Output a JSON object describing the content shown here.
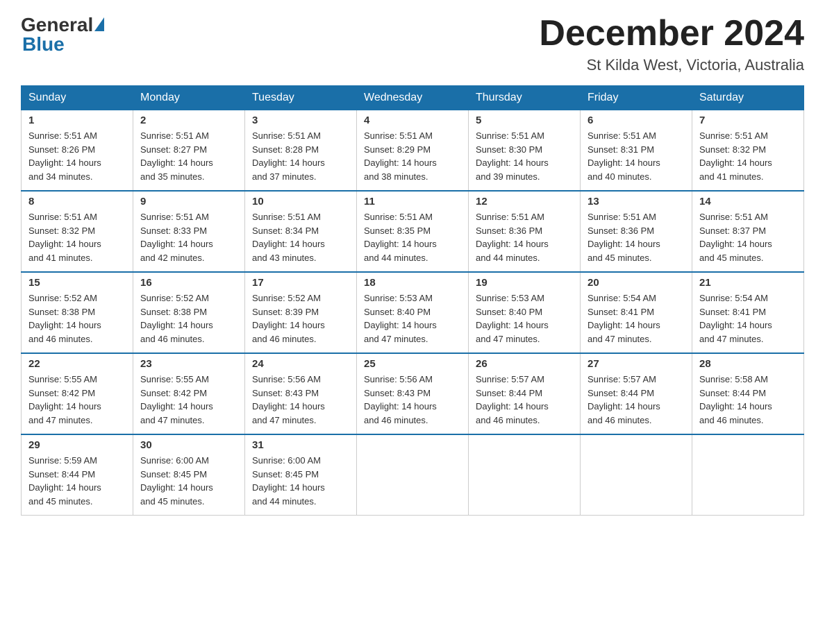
{
  "logo": {
    "text_general": "General",
    "text_blue": "Blue"
  },
  "header": {
    "month_year": "December 2024",
    "location": "St Kilda West, Victoria, Australia"
  },
  "days_of_week": [
    "Sunday",
    "Monday",
    "Tuesday",
    "Wednesday",
    "Thursday",
    "Friday",
    "Saturday"
  ],
  "weeks": [
    [
      {
        "day": "1",
        "sunrise": "5:51 AM",
        "sunset": "8:26 PM",
        "daylight": "14 hours and 34 minutes."
      },
      {
        "day": "2",
        "sunrise": "5:51 AM",
        "sunset": "8:27 PM",
        "daylight": "14 hours and 35 minutes."
      },
      {
        "day": "3",
        "sunrise": "5:51 AM",
        "sunset": "8:28 PM",
        "daylight": "14 hours and 37 minutes."
      },
      {
        "day": "4",
        "sunrise": "5:51 AM",
        "sunset": "8:29 PM",
        "daylight": "14 hours and 38 minutes."
      },
      {
        "day": "5",
        "sunrise": "5:51 AM",
        "sunset": "8:30 PM",
        "daylight": "14 hours and 39 minutes."
      },
      {
        "day": "6",
        "sunrise": "5:51 AM",
        "sunset": "8:31 PM",
        "daylight": "14 hours and 40 minutes."
      },
      {
        "day": "7",
        "sunrise": "5:51 AM",
        "sunset": "8:32 PM",
        "daylight": "14 hours and 41 minutes."
      }
    ],
    [
      {
        "day": "8",
        "sunrise": "5:51 AM",
        "sunset": "8:32 PM",
        "daylight": "14 hours and 41 minutes."
      },
      {
        "day": "9",
        "sunrise": "5:51 AM",
        "sunset": "8:33 PM",
        "daylight": "14 hours and 42 minutes."
      },
      {
        "day": "10",
        "sunrise": "5:51 AM",
        "sunset": "8:34 PM",
        "daylight": "14 hours and 43 minutes."
      },
      {
        "day": "11",
        "sunrise": "5:51 AM",
        "sunset": "8:35 PM",
        "daylight": "14 hours and 44 minutes."
      },
      {
        "day": "12",
        "sunrise": "5:51 AM",
        "sunset": "8:36 PM",
        "daylight": "14 hours and 44 minutes."
      },
      {
        "day": "13",
        "sunrise": "5:51 AM",
        "sunset": "8:36 PM",
        "daylight": "14 hours and 45 minutes."
      },
      {
        "day": "14",
        "sunrise": "5:51 AM",
        "sunset": "8:37 PM",
        "daylight": "14 hours and 45 minutes."
      }
    ],
    [
      {
        "day": "15",
        "sunrise": "5:52 AM",
        "sunset": "8:38 PM",
        "daylight": "14 hours and 46 minutes."
      },
      {
        "day": "16",
        "sunrise": "5:52 AM",
        "sunset": "8:38 PM",
        "daylight": "14 hours and 46 minutes."
      },
      {
        "day": "17",
        "sunrise": "5:52 AM",
        "sunset": "8:39 PM",
        "daylight": "14 hours and 46 minutes."
      },
      {
        "day": "18",
        "sunrise": "5:53 AM",
        "sunset": "8:40 PM",
        "daylight": "14 hours and 47 minutes."
      },
      {
        "day": "19",
        "sunrise": "5:53 AM",
        "sunset": "8:40 PM",
        "daylight": "14 hours and 47 minutes."
      },
      {
        "day": "20",
        "sunrise": "5:54 AM",
        "sunset": "8:41 PM",
        "daylight": "14 hours and 47 minutes."
      },
      {
        "day": "21",
        "sunrise": "5:54 AM",
        "sunset": "8:41 PM",
        "daylight": "14 hours and 47 minutes."
      }
    ],
    [
      {
        "day": "22",
        "sunrise": "5:55 AM",
        "sunset": "8:42 PM",
        "daylight": "14 hours and 47 minutes."
      },
      {
        "day": "23",
        "sunrise": "5:55 AM",
        "sunset": "8:42 PM",
        "daylight": "14 hours and 47 minutes."
      },
      {
        "day": "24",
        "sunrise": "5:56 AM",
        "sunset": "8:43 PM",
        "daylight": "14 hours and 47 minutes."
      },
      {
        "day": "25",
        "sunrise": "5:56 AM",
        "sunset": "8:43 PM",
        "daylight": "14 hours and 46 minutes."
      },
      {
        "day": "26",
        "sunrise": "5:57 AM",
        "sunset": "8:44 PM",
        "daylight": "14 hours and 46 minutes."
      },
      {
        "day": "27",
        "sunrise": "5:57 AM",
        "sunset": "8:44 PM",
        "daylight": "14 hours and 46 minutes."
      },
      {
        "day": "28",
        "sunrise": "5:58 AM",
        "sunset": "8:44 PM",
        "daylight": "14 hours and 46 minutes."
      }
    ],
    [
      {
        "day": "29",
        "sunrise": "5:59 AM",
        "sunset": "8:44 PM",
        "daylight": "14 hours and 45 minutes."
      },
      {
        "day": "30",
        "sunrise": "6:00 AM",
        "sunset": "8:45 PM",
        "daylight": "14 hours and 45 minutes."
      },
      {
        "day": "31",
        "sunrise": "6:00 AM",
        "sunset": "8:45 PM",
        "daylight": "14 hours and 44 minutes."
      },
      null,
      null,
      null,
      null
    ]
  ],
  "labels": {
    "sunrise": "Sunrise:",
    "sunset": "Sunset:",
    "daylight": "Daylight:"
  }
}
